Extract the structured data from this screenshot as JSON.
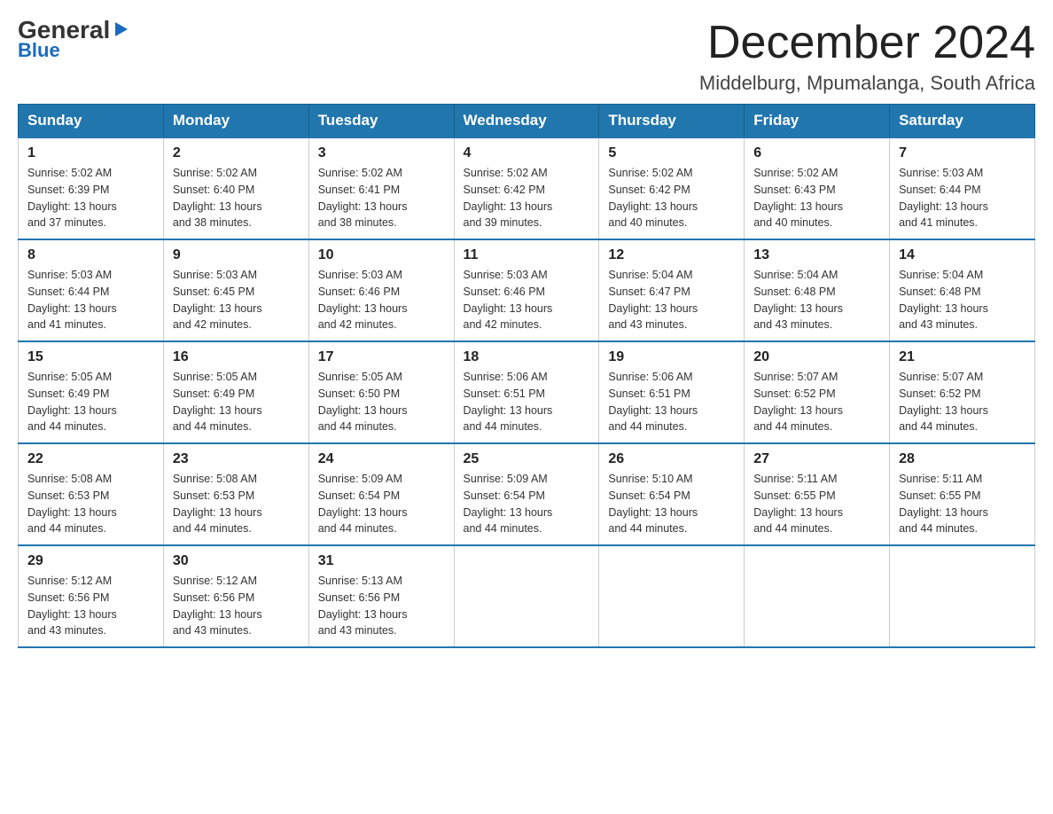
{
  "logo": {
    "general": "General",
    "blue": "Blue",
    "arrow": "▶"
  },
  "header": {
    "month": "December 2024",
    "location": "Middelburg, Mpumalanga, South Africa"
  },
  "weekdays": [
    "Sunday",
    "Monday",
    "Tuesday",
    "Wednesday",
    "Thursday",
    "Friday",
    "Saturday"
  ],
  "weeks": [
    [
      {
        "day": "1",
        "info": "Sunrise: 5:02 AM\nSunset: 6:39 PM\nDaylight: 13 hours\nand 37 minutes."
      },
      {
        "day": "2",
        "info": "Sunrise: 5:02 AM\nSunset: 6:40 PM\nDaylight: 13 hours\nand 38 minutes."
      },
      {
        "day": "3",
        "info": "Sunrise: 5:02 AM\nSunset: 6:41 PM\nDaylight: 13 hours\nand 38 minutes."
      },
      {
        "day": "4",
        "info": "Sunrise: 5:02 AM\nSunset: 6:42 PM\nDaylight: 13 hours\nand 39 minutes."
      },
      {
        "day": "5",
        "info": "Sunrise: 5:02 AM\nSunset: 6:42 PM\nDaylight: 13 hours\nand 40 minutes."
      },
      {
        "day": "6",
        "info": "Sunrise: 5:02 AM\nSunset: 6:43 PM\nDaylight: 13 hours\nand 40 minutes."
      },
      {
        "day": "7",
        "info": "Sunrise: 5:03 AM\nSunset: 6:44 PM\nDaylight: 13 hours\nand 41 minutes."
      }
    ],
    [
      {
        "day": "8",
        "info": "Sunrise: 5:03 AM\nSunset: 6:44 PM\nDaylight: 13 hours\nand 41 minutes."
      },
      {
        "day": "9",
        "info": "Sunrise: 5:03 AM\nSunset: 6:45 PM\nDaylight: 13 hours\nand 42 minutes."
      },
      {
        "day": "10",
        "info": "Sunrise: 5:03 AM\nSunset: 6:46 PM\nDaylight: 13 hours\nand 42 minutes."
      },
      {
        "day": "11",
        "info": "Sunrise: 5:03 AM\nSunset: 6:46 PM\nDaylight: 13 hours\nand 42 minutes."
      },
      {
        "day": "12",
        "info": "Sunrise: 5:04 AM\nSunset: 6:47 PM\nDaylight: 13 hours\nand 43 minutes."
      },
      {
        "day": "13",
        "info": "Sunrise: 5:04 AM\nSunset: 6:48 PM\nDaylight: 13 hours\nand 43 minutes."
      },
      {
        "day": "14",
        "info": "Sunrise: 5:04 AM\nSunset: 6:48 PM\nDaylight: 13 hours\nand 43 minutes."
      }
    ],
    [
      {
        "day": "15",
        "info": "Sunrise: 5:05 AM\nSunset: 6:49 PM\nDaylight: 13 hours\nand 44 minutes."
      },
      {
        "day": "16",
        "info": "Sunrise: 5:05 AM\nSunset: 6:49 PM\nDaylight: 13 hours\nand 44 minutes."
      },
      {
        "day": "17",
        "info": "Sunrise: 5:05 AM\nSunset: 6:50 PM\nDaylight: 13 hours\nand 44 minutes."
      },
      {
        "day": "18",
        "info": "Sunrise: 5:06 AM\nSunset: 6:51 PM\nDaylight: 13 hours\nand 44 minutes."
      },
      {
        "day": "19",
        "info": "Sunrise: 5:06 AM\nSunset: 6:51 PM\nDaylight: 13 hours\nand 44 minutes."
      },
      {
        "day": "20",
        "info": "Sunrise: 5:07 AM\nSunset: 6:52 PM\nDaylight: 13 hours\nand 44 minutes."
      },
      {
        "day": "21",
        "info": "Sunrise: 5:07 AM\nSunset: 6:52 PM\nDaylight: 13 hours\nand 44 minutes."
      }
    ],
    [
      {
        "day": "22",
        "info": "Sunrise: 5:08 AM\nSunset: 6:53 PM\nDaylight: 13 hours\nand 44 minutes."
      },
      {
        "day": "23",
        "info": "Sunrise: 5:08 AM\nSunset: 6:53 PM\nDaylight: 13 hours\nand 44 minutes."
      },
      {
        "day": "24",
        "info": "Sunrise: 5:09 AM\nSunset: 6:54 PM\nDaylight: 13 hours\nand 44 minutes."
      },
      {
        "day": "25",
        "info": "Sunrise: 5:09 AM\nSunset: 6:54 PM\nDaylight: 13 hours\nand 44 minutes."
      },
      {
        "day": "26",
        "info": "Sunrise: 5:10 AM\nSunset: 6:54 PM\nDaylight: 13 hours\nand 44 minutes."
      },
      {
        "day": "27",
        "info": "Sunrise: 5:11 AM\nSunset: 6:55 PM\nDaylight: 13 hours\nand 44 minutes."
      },
      {
        "day": "28",
        "info": "Sunrise: 5:11 AM\nSunset: 6:55 PM\nDaylight: 13 hours\nand 44 minutes."
      }
    ],
    [
      {
        "day": "29",
        "info": "Sunrise: 5:12 AM\nSunset: 6:56 PM\nDaylight: 13 hours\nand 43 minutes."
      },
      {
        "day": "30",
        "info": "Sunrise: 5:12 AM\nSunset: 6:56 PM\nDaylight: 13 hours\nand 43 minutes."
      },
      {
        "day": "31",
        "info": "Sunrise: 5:13 AM\nSunset: 6:56 PM\nDaylight: 13 hours\nand 43 minutes."
      },
      {
        "day": "",
        "info": ""
      },
      {
        "day": "",
        "info": ""
      },
      {
        "day": "",
        "info": ""
      },
      {
        "day": "",
        "info": ""
      }
    ]
  ]
}
